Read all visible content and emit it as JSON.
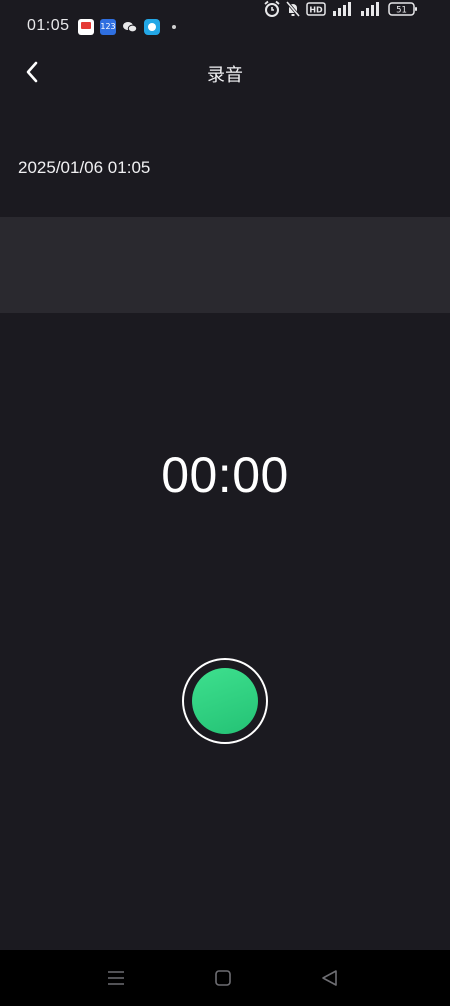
{
  "status_bar": {
    "time": "01:05",
    "notification_icons": [
      "mail-app-icon",
      "app-123-icon",
      "wechat-icon",
      "chat-bubble-icon"
    ],
    "battery_level": "51",
    "hd_badge": "HD"
  },
  "header": {
    "title": "录音"
  },
  "recording": {
    "name": "2025/01/06 01:05",
    "elapsed": "00:00"
  },
  "nav_bar": {
    "buttons": [
      "menu-icon",
      "home-icon",
      "back-triangle-icon"
    ]
  },
  "colors": {
    "background": "#1b1a20",
    "waveform_band": "#2a292f",
    "record_accent": "#2fd17f",
    "nav_background": "#000000"
  }
}
